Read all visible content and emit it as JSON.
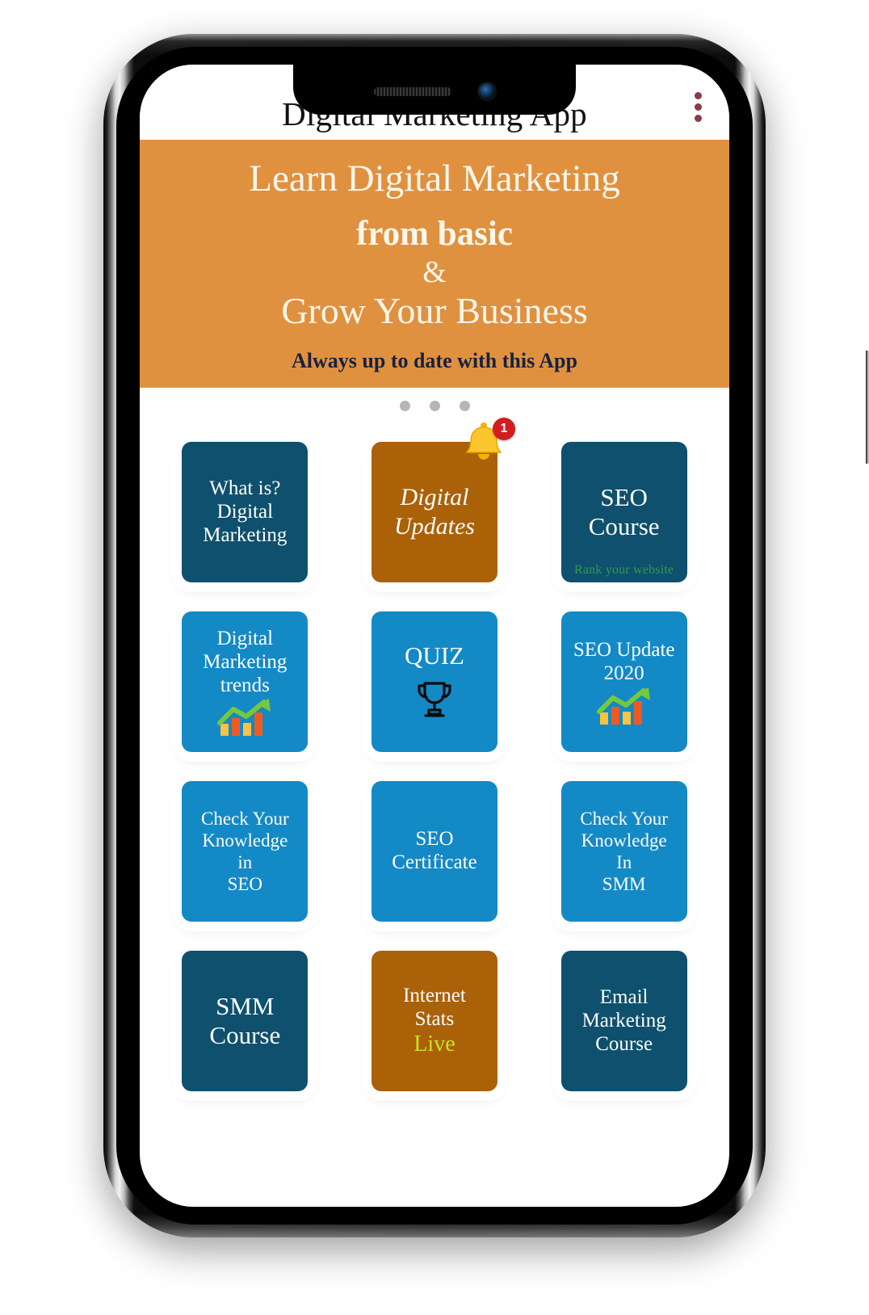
{
  "app": {
    "title": "Digital Marketing App",
    "overflow_menu_icon": "three-dot-menu-icon",
    "accent_orange": "#e0913f",
    "accent_teal": "#0e506d",
    "accent_blue": "#1389c6",
    "accent_brown": "#ab6108",
    "menu_dot_color": "#8b3a46"
  },
  "banner": {
    "line1": "Learn Digital Marketing",
    "line2": "from basic",
    "amp": "&",
    "line3": "Grow Your Business",
    "subtitle": "Always up to date with this App"
  },
  "carousel": {
    "dot_count": 3,
    "active_index": 0
  },
  "tiles": [
    {
      "label": "What is?\nDigital\nMarketing",
      "style": "teal",
      "size": "sm",
      "icon": "",
      "subtitle": "",
      "badge": ""
    },
    {
      "label": "Digital\nUpdates",
      "style": "brown",
      "size": "italic",
      "icon": "bell-notification-icon",
      "subtitle": "",
      "badge": "1"
    },
    {
      "label": "SEO\nCourse",
      "style": "teal",
      "size": "lg",
      "icon": "",
      "subtitle": "Rank your website",
      "badge": ""
    },
    {
      "label": "Digital\nMarketing\ntrends",
      "style": "blue",
      "size": "sm",
      "icon": "growth-chart-icon",
      "subtitle": "",
      "badge": ""
    },
    {
      "label": "QUIZ",
      "style": "blue",
      "size": "lg",
      "icon": "trophy-icon",
      "subtitle": "",
      "badge": ""
    },
    {
      "label": "SEO Update\n2020",
      "style": "blue",
      "size": "sm",
      "icon": "growth-chart-icon",
      "subtitle": "",
      "badge": ""
    },
    {
      "label": "Check Your\nKnowledge\nin\nSEO",
      "style": "blue",
      "size": "xs",
      "icon": "",
      "subtitle": "",
      "badge": ""
    },
    {
      "label": "SEO\nCertificate",
      "style": "blue",
      "size": "sm",
      "icon": "",
      "subtitle": "",
      "badge": ""
    },
    {
      "label": "Check Your\nKnowledge\nIn\nSMM",
      "style": "blue",
      "size": "xs",
      "icon": "",
      "subtitle": "",
      "badge": ""
    },
    {
      "label": "SMM\nCourse",
      "style": "teal",
      "size": "lg",
      "icon": "",
      "subtitle": "",
      "badge": ""
    },
    {
      "label": "Internet\nStats",
      "style": "brown",
      "size": "sm",
      "icon": "",
      "subtitle": "Live",
      "badge": ""
    },
    {
      "label": "Email\nMarketing\nCourse",
      "style": "teal",
      "size": "sm",
      "icon": "",
      "subtitle": "",
      "badge": ""
    }
  ],
  "device": {
    "notch_speaker": "speaker-grille",
    "notch_camera": "front-camera",
    "buttons": [
      "silent-switch",
      "volume-up",
      "volume-down",
      "power-button"
    ]
  }
}
